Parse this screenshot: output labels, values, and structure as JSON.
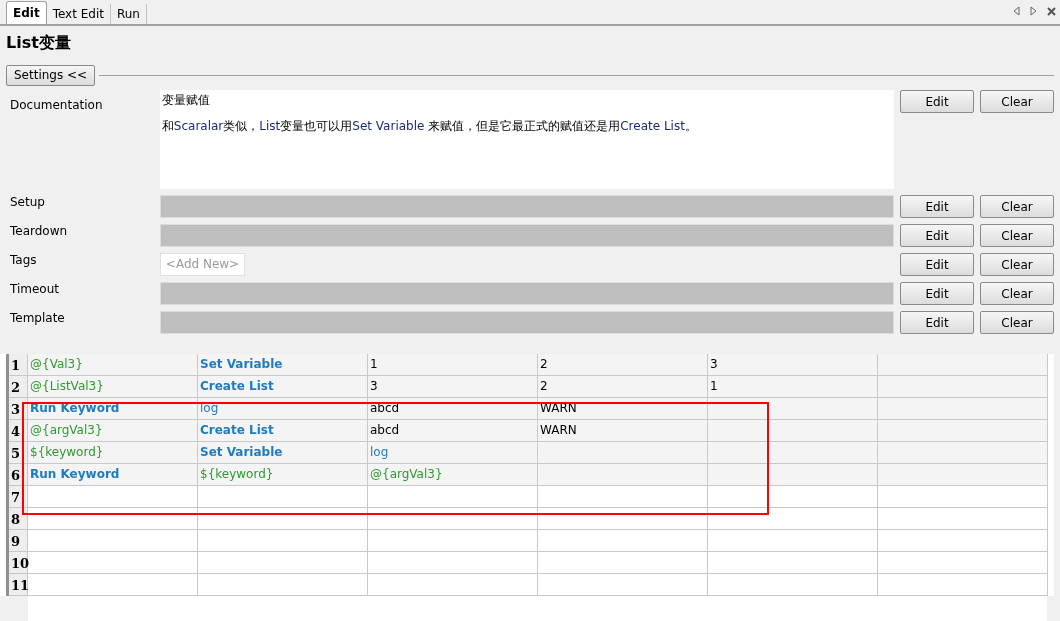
{
  "tabs": [
    {
      "label": "Edit",
      "selected": true
    },
    {
      "label": "Text Edit",
      "selected": false
    },
    {
      "label": "Run",
      "selected": false
    }
  ],
  "title": "List变量",
  "settings_button": "Settings <<",
  "documentation": {
    "label": "Documentation",
    "lines": [
      [
        {
          "text": "变量赋值",
          "kind": "plain"
        }
      ],
      [
        {
          "text": "和",
          "kind": "plain"
        },
        {
          "text": "Scaralar",
          "kind": "name"
        },
        {
          "text": "类似，",
          "kind": "plain"
        },
        {
          "text": "List",
          "kind": "name"
        },
        {
          "text": "变量也可以用",
          "kind": "plain"
        },
        {
          "text": "Set Variable",
          "kind": "name"
        },
        {
          "text": " 来赋值，但是它最正式的赋值还是用",
          "kind": "plain"
        },
        {
          "text": "Create List",
          "kind": "name"
        },
        {
          "text": "。",
          "kind": "plain"
        }
      ]
    ],
    "buttons": [
      "Edit",
      "Clear"
    ]
  },
  "settings": [
    {
      "label": "Setup",
      "kind": "field",
      "buttons": [
        "Edit",
        "Clear"
      ]
    },
    {
      "label": "Teardown",
      "kind": "field",
      "buttons": [
        "Edit",
        "Clear"
      ]
    },
    {
      "label": "Tags",
      "kind": "tags",
      "placeholder": "<Add New>",
      "buttons": [
        "Edit",
        "Clear"
      ]
    },
    {
      "label": "Timeout",
      "kind": "field",
      "buttons": [
        "Edit",
        "Clear"
      ]
    },
    {
      "label": "Template",
      "kind": "field",
      "buttons": [
        "Edit",
        "Clear"
      ]
    }
  ],
  "grid": {
    "rows": [
      {
        "number": "1",
        "cells": [
          {
            "text": "@{Val3}",
            "kind": "variable"
          },
          {
            "text": "Set Variable",
            "kind": "keyword"
          },
          {
            "text": "1",
            "kind": "plain"
          },
          {
            "text": "2",
            "kind": "plain"
          },
          {
            "text": "3",
            "kind": "plain"
          }
        ]
      },
      {
        "number": "2",
        "cells": [
          {
            "text": "@{ListVal3}",
            "kind": "variable"
          },
          {
            "text": "Create List",
            "kind": "keyword"
          },
          {
            "text": "3",
            "kind": "plain"
          },
          {
            "text": "2",
            "kind": "plain"
          },
          {
            "text": "1",
            "kind": "plain"
          }
        ]
      },
      {
        "number": "3",
        "cells": [
          {
            "text": "Run Keyword",
            "kind": "keyword"
          },
          {
            "text": "log",
            "kind": "argument"
          },
          {
            "text": "abcd",
            "kind": "plain"
          },
          {
            "text": "WARN",
            "kind": "plain"
          }
        ]
      },
      {
        "number": "4",
        "cells": [
          {
            "text": "@{argVal3}",
            "kind": "variable"
          },
          {
            "text": "Create List",
            "kind": "keyword"
          },
          {
            "text": "abcd",
            "kind": "plain"
          },
          {
            "text": "WARN",
            "kind": "plain"
          }
        ]
      },
      {
        "number": "5",
        "cells": [
          {
            "text": "${keyword}",
            "kind": "variable"
          },
          {
            "text": "Set Variable",
            "kind": "keyword"
          },
          {
            "text": "log",
            "kind": "argument"
          }
        ]
      },
      {
        "number": "6",
        "cells": [
          {
            "text": "Run Keyword",
            "kind": "keyword"
          },
          {
            "text": "${keyword}",
            "kind": "variable"
          },
          {
            "text": "@{argVal3}",
            "kind": "variable"
          }
        ]
      },
      {
        "number": "7",
        "cells": []
      },
      {
        "number": "8",
        "cells": []
      },
      {
        "number": "9",
        "cells": []
      },
      {
        "number": "10",
        "cells": []
      },
      {
        "number": "11",
        "cells": []
      }
    ]
  }
}
